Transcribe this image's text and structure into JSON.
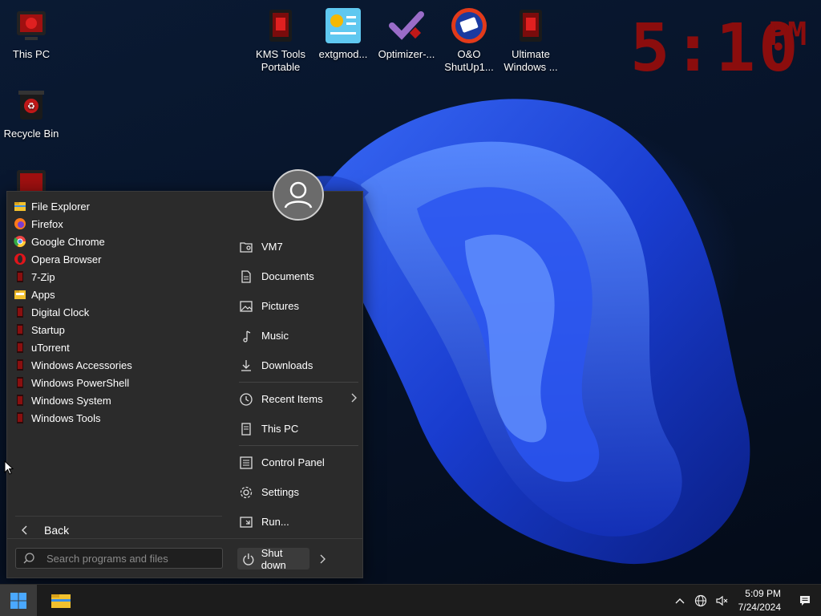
{
  "desktop": {
    "icons": [
      {
        "label": "This PC",
        "icon": "this-pc-icon"
      },
      {
        "label": "Recycle Bin",
        "icon": "recycle-bin-icon"
      },
      {
        "label": "",
        "icon": "folder-shortcut-icon"
      },
      {
        "label": "KMS Tools\nPortable",
        "icon": "kms-tools-icon"
      },
      {
        "label": "extgmod...",
        "icon": "extgmod-icon"
      },
      {
        "label": "Optimizer-...",
        "icon": "optimizer-icon"
      },
      {
        "label": "O&O\nShutUp1...",
        "icon": "oo-shutup-icon"
      },
      {
        "label": "Ultimate\nWindows ...",
        "icon": "ultimate-windows-icon"
      }
    ],
    "clock": {
      "time": "5:10",
      "ampm": "PM",
      "color": "#8b0d0d"
    }
  },
  "start_menu": {
    "programs": [
      {
        "label": "File Explorer",
        "icon": "file-explorer-icon"
      },
      {
        "label": "Firefox",
        "icon": "firefox-icon"
      },
      {
        "label": "Google Chrome",
        "icon": "chrome-icon"
      },
      {
        "label": "Opera Browser",
        "icon": "opera-icon"
      },
      {
        "label": "7-Zip",
        "icon": "folder-red-icon"
      },
      {
        "label": "Apps",
        "icon": "folder-yellow-icon"
      },
      {
        "label": "Digital Clock",
        "icon": "folder-red-icon"
      },
      {
        "label": "Startup",
        "icon": "folder-red-icon"
      },
      {
        "label": "uTorrent",
        "icon": "folder-red-icon"
      },
      {
        "label": "Windows Accessories",
        "icon": "folder-red-icon"
      },
      {
        "label": "Windows PowerShell",
        "icon": "folder-red-icon"
      },
      {
        "label": "Windows System",
        "icon": "folder-red-icon"
      },
      {
        "label": "Windows Tools",
        "icon": "folder-red-icon"
      }
    ],
    "places": [
      {
        "label": "VM7",
        "icon": "user-folder-icon"
      },
      {
        "label": "Documents",
        "icon": "document-icon"
      },
      {
        "label": "Pictures",
        "icon": "picture-icon"
      },
      {
        "label": "Music",
        "icon": "music-icon"
      },
      {
        "label": "Downloads",
        "icon": "download-icon"
      },
      {
        "label": "Recent Items",
        "icon": "clock-icon",
        "has_submenu": true
      },
      {
        "label": "This PC",
        "icon": "computer-icon"
      },
      {
        "label": "Control Panel",
        "icon": "control-panel-icon"
      },
      {
        "label": "Settings",
        "icon": "settings-gear-icon"
      },
      {
        "label": "Run...",
        "icon": "run-icon"
      }
    ],
    "back_label": "Back",
    "search_placeholder": "Search programs and files",
    "shutdown_label": "Shut down"
  },
  "taskbar": {
    "time": "5:09 PM",
    "date": "7/24/2024"
  }
}
